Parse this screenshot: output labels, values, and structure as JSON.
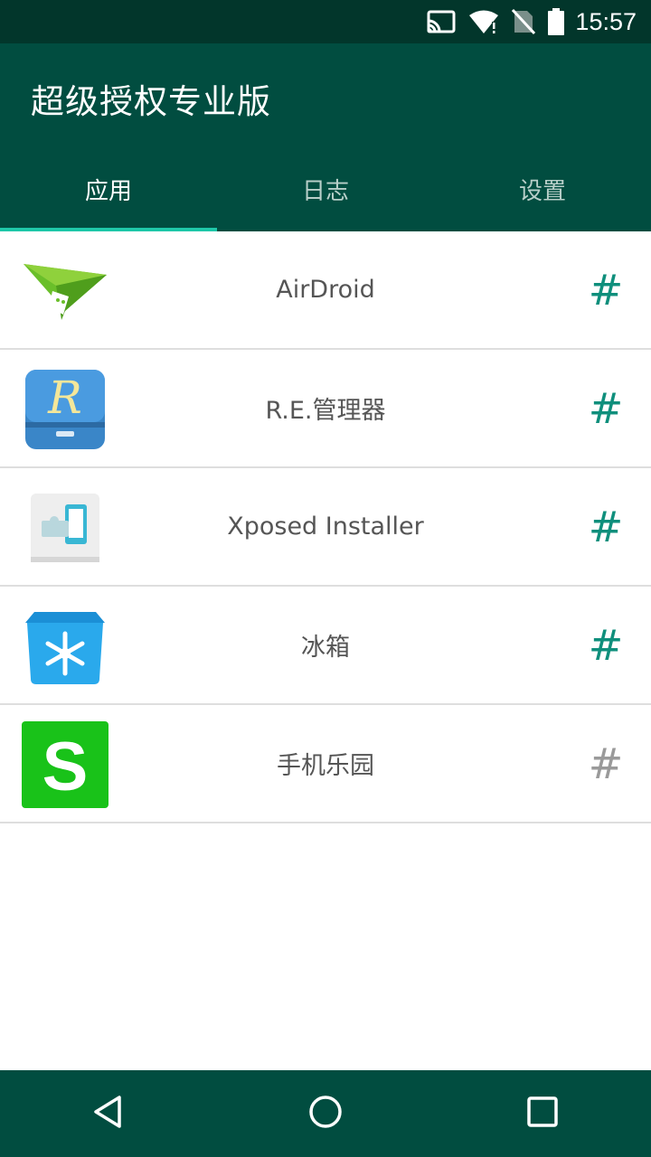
{
  "status_bar": {
    "time": "15:57",
    "icons": [
      "cast-icon",
      "wifi-icon",
      "no-sim-icon",
      "battery-icon"
    ]
  },
  "app_bar": {
    "title": "超级授权专业版"
  },
  "tabs": [
    {
      "label": "应用",
      "active": true
    },
    {
      "label": "日志",
      "active": false
    },
    {
      "label": "设置",
      "active": false
    }
  ],
  "apps": [
    {
      "name": "AirDroid",
      "icon": "airdroid-icon",
      "hash": "#",
      "hash_color": "#0f8f7c"
    },
    {
      "name": "R.E.管理器",
      "icon": "re-manager-icon",
      "hash": "#",
      "hash_color": "#0f8f7c"
    },
    {
      "name": "Xposed Installer",
      "icon": "xposed-icon",
      "hash": "#",
      "hash_color": "#0f8f7c"
    },
    {
      "name": "冰箱",
      "icon": "ice-box-icon",
      "hash": "#",
      "hash_color": "#0f8f7c"
    },
    {
      "name": "手机乐园",
      "icon": "shouji-leyuan-icon",
      "hash": "#",
      "hash_color": "#9a9a9a"
    }
  ],
  "nav_bar": {
    "buttons": [
      "back-icon",
      "home-icon",
      "recents-icon"
    ]
  },
  "colors": {
    "status_bar_bg": "#02362b",
    "app_bar_bg": "#014d40",
    "tab_indicator": "#1ec7a8",
    "granted_hash": "#0f8f7c",
    "denied_hash": "#9a9a9a"
  }
}
